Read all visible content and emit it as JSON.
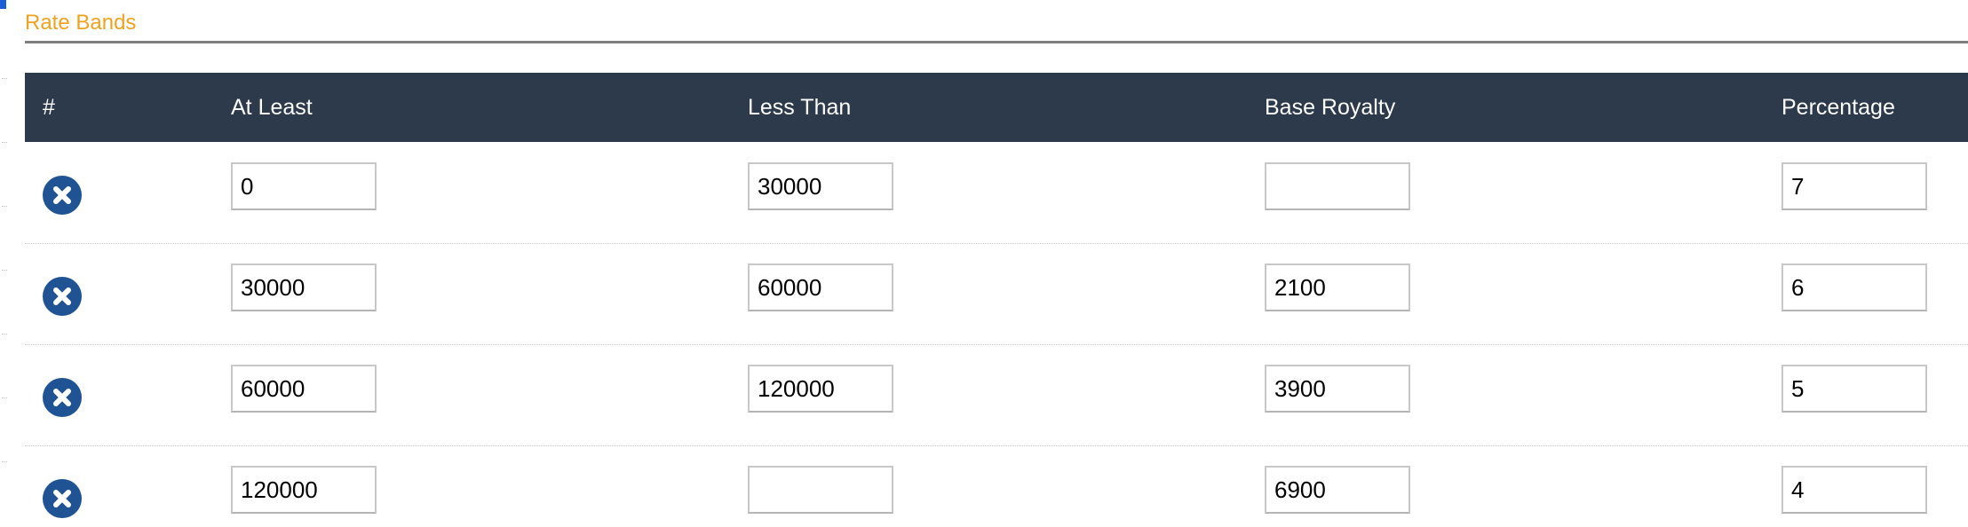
{
  "section": {
    "title": "Rate Bands"
  },
  "table": {
    "headers": {
      "index": "#",
      "at_least": "At Least",
      "less_than": "Less Than",
      "base_royalty": "Base Royalty",
      "percentage": "Percentage"
    },
    "rows": [
      {
        "at_least": "0",
        "less_than": "30000",
        "base_royalty": "",
        "percentage": "7"
      },
      {
        "at_least": "30000",
        "less_than": "60000",
        "base_royalty": "2100",
        "percentage": "6"
      },
      {
        "at_least": "60000",
        "less_than": "120000",
        "base_royalty": "3900",
        "percentage": "5"
      },
      {
        "at_least": "120000",
        "less_than": "",
        "base_royalty": "6900",
        "percentage": "4"
      }
    ],
    "remove_icon": "remove-circle-x-icon"
  },
  "colors": {
    "title": "#f0a21f",
    "header_bg": "#2c3a4b",
    "remove_button": "#1f5393",
    "rule": "#7f7f7f"
  }
}
